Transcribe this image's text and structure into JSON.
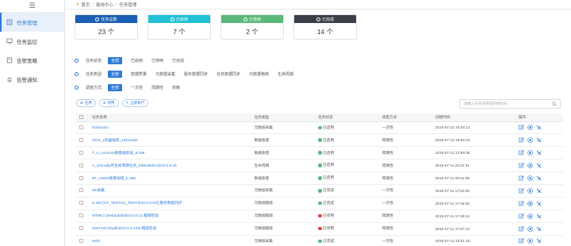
{
  "sidebar": {
    "items": [
      {
        "label": "任务管理",
        "icon": "task-list-icon",
        "active": true
      },
      {
        "label": "任务监控",
        "icon": "monitor-icon",
        "active": false
      },
      {
        "label": "告警策略",
        "icon": "alert-policy-icon",
        "active": false
      },
      {
        "label": "告警通知",
        "icon": "bell-icon",
        "active": false
      }
    ]
  },
  "breadcrumb": {
    "home": "首页",
    "level2": "离线中心",
    "current": "任务管理"
  },
  "cards": [
    {
      "label": "任务总数",
      "value": "23 个",
      "color": "#1a5fb4"
    },
    {
      "label": "已启用",
      "value": "7 个",
      "color": "#22c1d6"
    },
    {
      "label": "已停用",
      "value": "2 个",
      "color": "#5cb87a"
    },
    {
      "label": "已完成",
      "value": "14 个",
      "color": "#3a3f4a"
    }
  ],
  "filters": {
    "status": {
      "label": "任务状态:",
      "options": [
        "全部",
        "已启用",
        "已停用",
        "已完成"
      ],
      "selected": 0
    },
    "type": {
      "label": "任务类型:",
      "options": [
        "全部",
        "数据质量",
        "元数据采集",
        "服务数据同步",
        "任务数据同步",
        "元数据稽核",
        "生命周期"
      ],
      "selected": 0
    },
    "schedule": {
      "label": "调度方式:",
      "options": [
        "全部",
        "一次性",
        "周期性",
        "依赖"
      ],
      "selected": 0
    }
  },
  "toolbar": {
    "enable": "启用",
    "disable": "停用",
    "run_now": "立即执行"
  },
  "search": {
    "placeholder": "请输入任务名称或开始时间"
  },
  "table": {
    "headers": [
      "任务名称",
      "任务类型",
      "任务状态",
      "调度方式",
      "创建时间",
      "操作"
    ],
    "rows": [
      {
        "name": "bzdsxxsct",
        "type": "元数据采集",
        "status": "已启用",
        "status_kind": "ok",
        "schedule": "一次性",
        "time": "2019-07-12 15:34:13"
      },
      {
        "name": "OOS_1机器规则_142oracle",
        "type": "数据质量",
        "status": "已启用",
        "status_kind": "ok",
        "schedule": "周期性",
        "time": "2019-07-12 15:05:33"
      },
      {
        "name": "T_A_cmscms质量规则设_8.199",
        "type": "数据质量",
        "status": "已启用",
        "status_kind": "ok",
        "schedule": "周期性",
        "time": "2019-07-12 13:59:38"
      },
      {
        "name": "A_Gmnddy的生命周期任务_fdd5195DA@10.0.0.45",
        "type": "生命周期",
        "status": "已启用",
        "status_kind": "ok",
        "schedule": "周期性",
        "time": "2019-07-11 20:22:31"
      },
      {
        "name": "BT_USER质量规则_b.199",
        "type": "数据质量",
        "status": "已启用",
        "status_kind": "ok",
        "schedule": "周期性",
        "time": "2019-07-11 20:51:08"
      },
      {
        "name": "dm采集",
        "type": "元数据采集",
        "status": "已完成",
        "status_kind": "ok",
        "schedule": "一次性",
        "time": "2019-07-11 17:53:35"
      },
      {
        "name": "8.199 (GT_TEST01)_TEST@10.0.0.57[] 服务数据同步",
        "type": "元数据稽核",
        "status": "已完成",
        "status_kind": "ok",
        "schedule": "一次性",
        "time": "2019-07-11 17:45:45"
      },
      {
        "name": "MT99.2 (test/pubdb@10.0.0.2) 稽核检验",
        "type": "元数据稽核",
        "status": "已停用",
        "status_kind": "stopped",
        "schedule": "周期性",
        "time": "2019-07-11 17:49:34"
      },
      {
        "name": "HWT103 (fcpdb@10.0.0.103) 稽核检验",
        "type": "元数据稽核",
        "status": "已停用",
        "status_kind": "stopped",
        "schedule": "周期性",
        "time": "2019-07-11 17:07:13"
      },
      {
        "name": "test1",
        "type": "元数据采集",
        "status": "已完成",
        "status_kind": "ok",
        "schedule": "一次性",
        "time": "2019-07-12 15:51:15"
      }
    ]
  },
  "colors": {
    "accent": "#2d7bd6",
    "ok": "#5cb87a",
    "stopped": "#e0443b"
  }
}
